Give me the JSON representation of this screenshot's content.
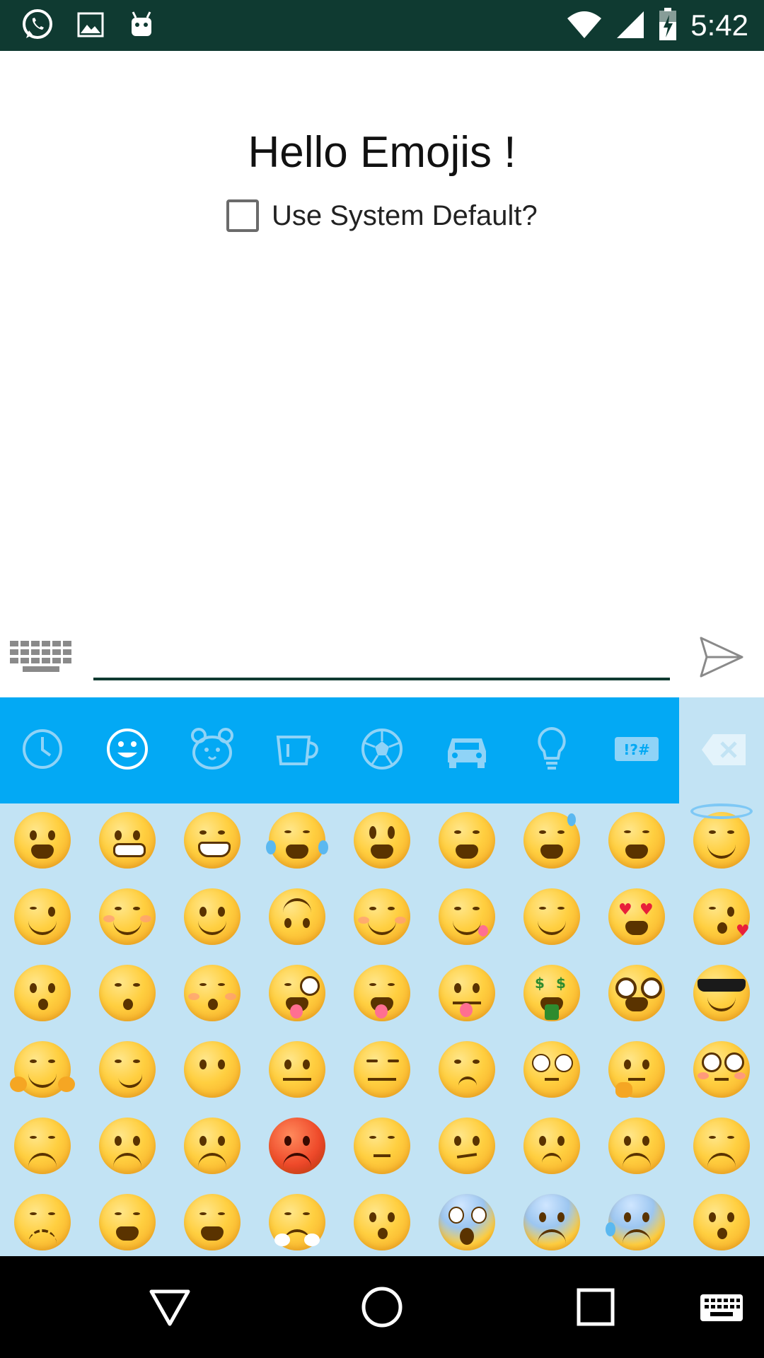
{
  "status_bar": {
    "time": "5:42",
    "left_icons": [
      "whatsapp-icon",
      "image-icon",
      "android-icon"
    ],
    "right_icons": [
      "wifi-icon",
      "cell-signal-icon",
      "battery-icon"
    ]
  },
  "main": {
    "title": "Hello Emojis !",
    "checkbox_label": "Use System Default?",
    "checkbox_checked": false
  },
  "input": {
    "value": "",
    "placeholder": ""
  },
  "emoji_panel": {
    "categories": [
      "recent-icon",
      "smiley-icon",
      "animal-icon",
      "food-cup-icon",
      "sports-ball-icon",
      "car-icon",
      "lightbulb-icon",
      "symbols-icon"
    ],
    "selected_category": "smiley-icon",
    "rows": 6,
    "columns": 9
  },
  "colors": {
    "status_bar": "#0f3a31",
    "accent": "#03a9f4",
    "panel_background": "#c2e3f4",
    "nav_bar": "#000000"
  },
  "nav": [
    "back-icon",
    "home-icon",
    "recents-icon",
    "keyboard-icon"
  ]
}
